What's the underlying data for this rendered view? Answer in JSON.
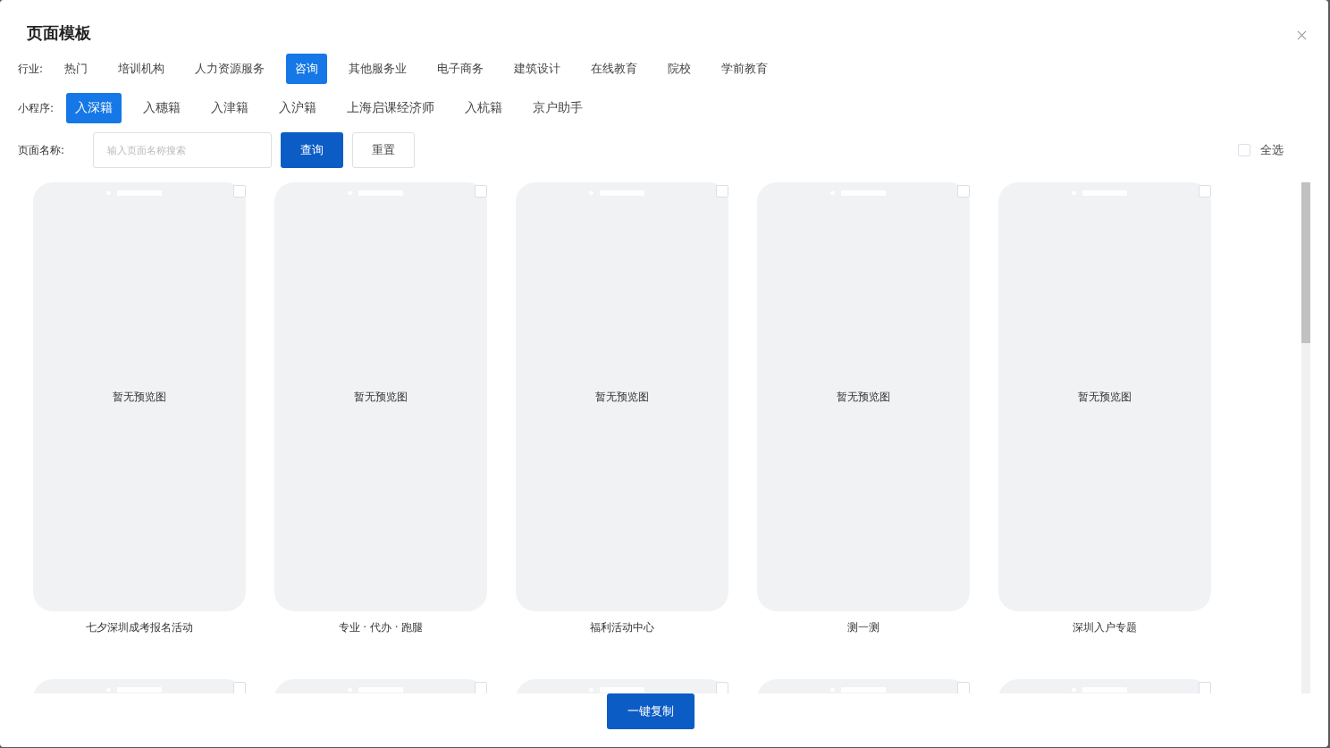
{
  "dialog": {
    "title": "页面模板"
  },
  "industry": {
    "label": "行业:",
    "tabs": [
      {
        "label": "热门",
        "selected": false
      },
      {
        "label": "培训机构",
        "selected": false
      },
      {
        "label": "人力资源服务",
        "selected": false
      },
      {
        "label": "咨询",
        "selected": true
      },
      {
        "label": "其他服务业",
        "selected": false
      },
      {
        "label": "电子商务",
        "selected": false
      },
      {
        "label": "建筑设计",
        "selected": false
      },
      {
        "label": "在线教育",
        "selected": false
      },
      {
        "label": "院校",
        "selected": false
      },
      {
        "label": "学前教育",
        "selected": false
      }
    ]
  },
  "mini_program": {
    "label": "小程序:",
    "tabs": [
      {
        "label": "入深籍",
        "selected": true
      },
      {
        "label": "入穗籍",
        "selected": false
      },
      {
        "label": "入津籍",
        "selected": false
      },
      {
        "label": "入沪籍",
        "selected": false
      },
      {
        "label": "上海启课经济师",
        "selected": false
      },
      {
        "label": "入杭籍",
        "selected": false
      },
      {
        "label": "京户助手",
        "selected": false
      }
    ]
  },
  "search": {
    "label": "页面名称:",
    "placeholder": "输入页面名称搜索",
    "query_button": "查询",
    "reset_button": "重置"
  },
  "select_all": {
    "label": "全选",
    "checked": false
  },
  "templates": [
    {
      "title": "七夕深圳成考报名活动",
      "preview_text": "暂无预览图",
      "checked": false
    },
    {
      "title": "专业 · 代办 · 跑腿",
      "preview_text": "暂无预览图",
      "checked": false
    },
    {
      "title": "福利活动中心",
      "preview_text": "暂无预览图",
      "checked": false
    },
    {
      "title": "测一测",
      "preview_text": "暂无预览图",
      "checked": false
    },
    {
      "title": "深圳入户专题",
      "preview_text": "暂无预览图",
      "checked": false
    },
    {
      "checked": false
    },
    {
      "checked": false
    },
    {
      "checked": false
    },
    {
      "checked": false
    },
    {
      "checked": false
    }
  ],
  "footer": {
    "copy_button": "一键复制"
  }
}
